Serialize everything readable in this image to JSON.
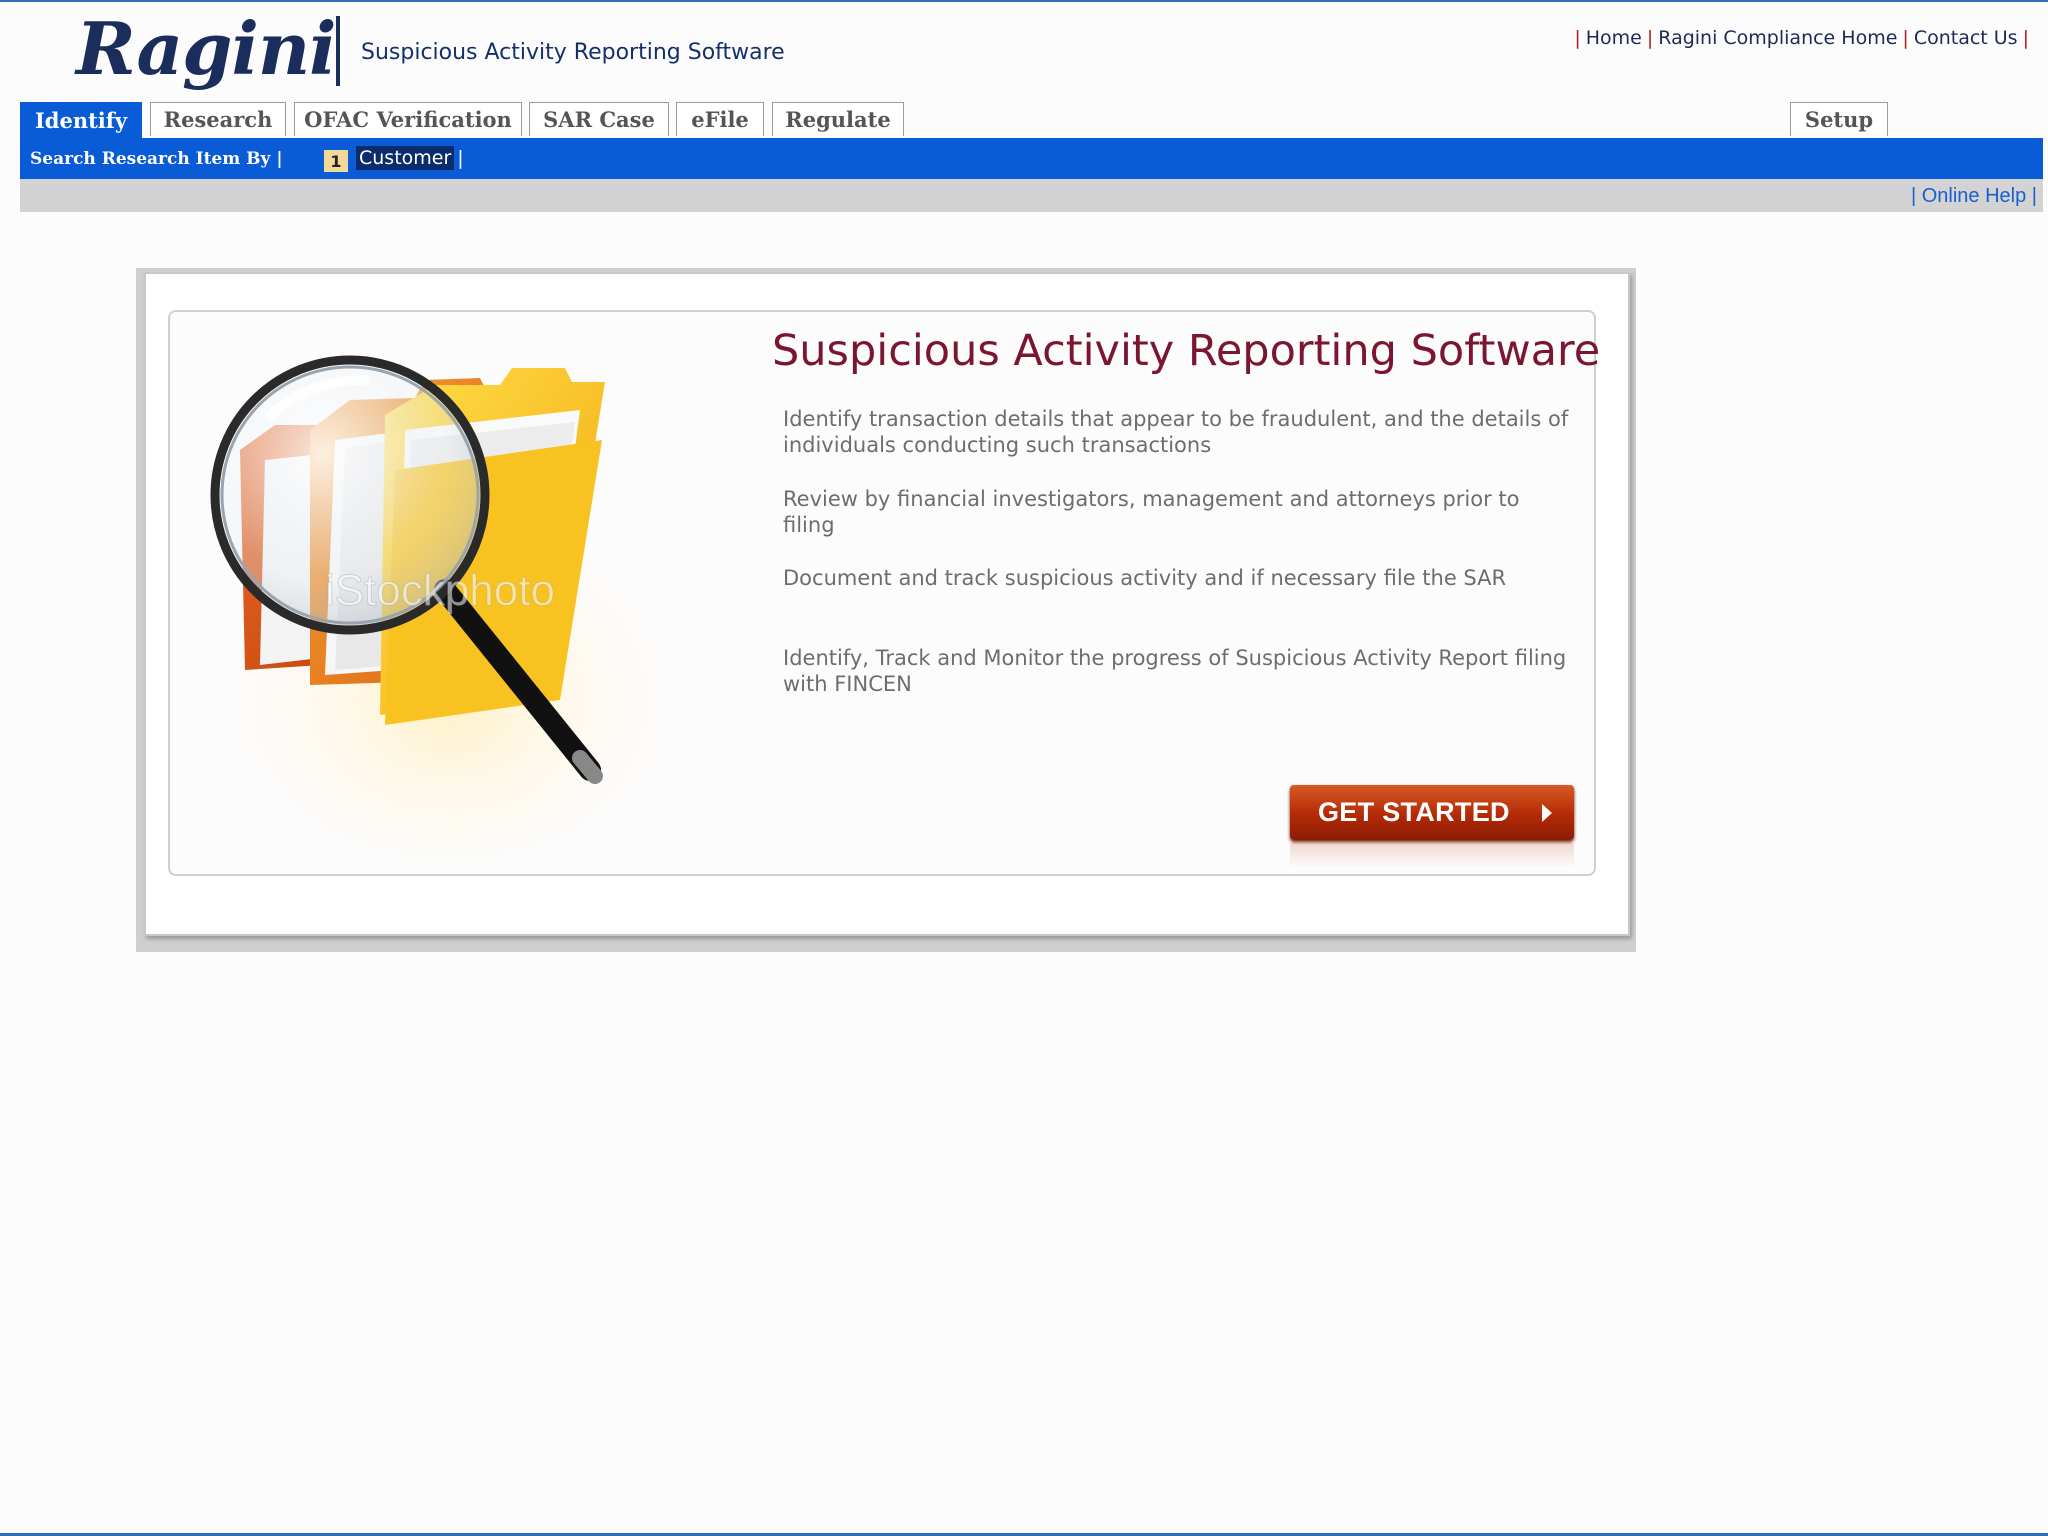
{
  "header": {
    "logo_text": "Ragini",
    "subtitle": "Suspicious Activity Reporting Software",
    "links": [
      {
        "label": "Home"
      },
      {
        "label": "Ragini Compliance Home"
      },
      {
        "label": "Contact Us"
      }
    ]
  },
  "tabs": [
    {
      "label": "Identify",
      "active": true
    },
    {
      "label": "Research"
    },
    {
      "label": "OFAC Verification"
    },
    {
      "label": "SAR Case"
    },
    {
      "label": "eFile"
    },
    {
      "label": "Regulate"
    },
    {
      "label": "Setup"
    }
  ],
  "subnav": {
    "label": "Search Research Item By |",
    "badge": "1",
    "customer": "Customer"
  },
  "helpbar": {
    "link": "Online Help"
  },
  "content": {
    "title": "Suspicious Activity Reporting Software",
    "descriptions": [
      "Identify transaction details that appear to be fraudulent, and the details of individuals conducting such transactions",
      "Review by financial investigators, management and attorneys prior to filing",
      "Document and track suspicious activity and if necessary file the SAR",
      "Identify, Track and Monitor the progress of Suspicious Activity Report filing with FINCEN"
    ],
    "watermark": "iStockphoto",
    "cta_label": "GET STARTED"
  },
  "colors": {
    "nav_blue": "#0a5bd6",
    "brand_navy": "#1b2d5b",
    "title_maroon": "#7b1530",
    "cta_orange": "#b32a06"
  }
}
